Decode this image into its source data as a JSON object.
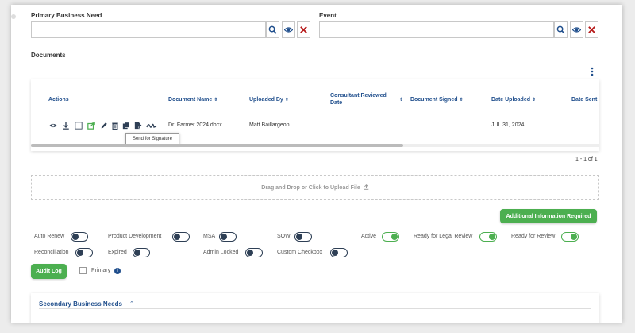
{
  "fields": {
    "primary_business_need": {
      "label": "Primary Business Need",
      "value": ""
    },
    "event": {
      "label": "Event",
      "value": ""
    }
  },
  "documents": {
    "section_title": "Documents",
    "columns": [
      {
        "label": "Actions",
        "sortable": false
      },
      {
        "label": "Document Name",
        "sortable": true
      },
      {
        "label": "Uploaded By",
        "sortable": true
      },
      {
        "label": "Consultant Reviewed Date",
        "sortable": true
      },
      {
        "label": "Document Signed",
        "sortable": true
      },
      {
        "label": "Date Uploaded",
        "sortable": true
      },
      {
        "label": "Date Sent",
        "sortable": false
      }
    ],
    "rows": [
      {
        "document_name": "Dr. Farmer 2024.docx",
        "uploaded_by": "Matt Baillargeon",
        "consultant_reviewed_date": "",
        "document_signed": "",
        "date_uploaded": "JUL 31, 2024",
        "date_sent": ""
      }
    ],
    "tooltip": "Send for Signature",
    "pagination": "1 - 1 of 1",
    "upload_text": "Drag and Drop or Click to Upload File",
    "upload_icon": "upload-icon"
  },
  "buttons": {
    "additional_info": "Additional Information Required",
    "audit_log": "Audit Log"
  },
  "toggles": [
    {
      "label": "Auto Renew",
      "on": false
    },
    {
      "label": "Product Development",
      "on": false
    },
    {
      "label": "MSA",
      "on": false
    },
    {
      "label": "SOW",
      "on": false
    },
    {
      "label": "Active",
      "on": true
    },
    {
      "label": "Ready for Legal Review",
      "on": true
    },
    {
      "label": "Ready for Review",
      "on": true
    },
    {
      "label": "Reconciliation",
      "on": false
    },
    {
      "label": "Expired",
      "on": false
    },
    {
      "label": "Admin Locked",
      "on": false
    },
    {
      "label": "Custom Checkbox",
      "on": false
    }
  ],
  "primary_checkbox": {
    "label": "Primary",
    "checked": false
  },
  "secondary": {
    "title": "Secondary Business Needs"
  },
  "colors": {
    "accent": "#4caf50",
    "navy": "#1f4e8c",
    "danger": "#b71c1c",
    "toggle_off": "#2e3f55"
  }
}
